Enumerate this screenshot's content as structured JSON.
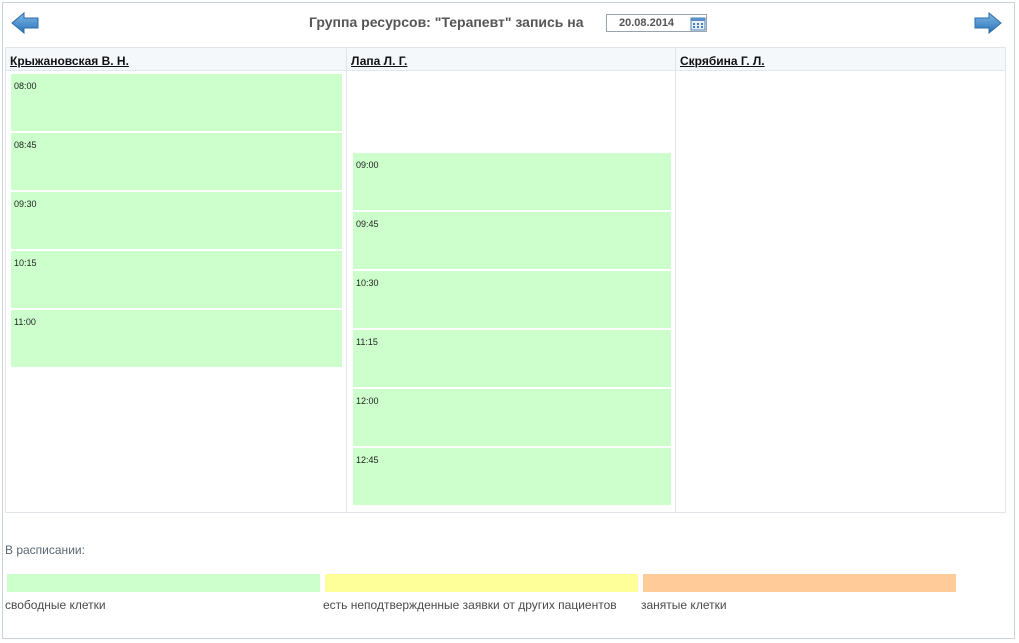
{
  "header": {
    "title": "Группа ресурсов: \"Терапевт\" запись на",
    "date": "20.08.2014",
    "prev_icon": "arrow-left-icon",
    "next_icon": "arrow-right-icon",
    "calendar_icon": "calendar-icon"
  },
  "columns": [
    {
      "name": "Крыжановская В. Н.",
      "slots": [
        "08:00",
        "08:45",
        "09:30",
        "10:15",
        "11:00"
      ]
    },
    {
      "name": "Лапа Л. Г.",
      "slots": [
        "09:00",
        "09:45",
        "10:30",
        "11:15",
        "12:00",
        "12:45"
      ]
    },
    {
      "name": "Скрябина Г. Л.",
      "slots": []
    }
  ],
  "legend": {
    "title": "В расписании:",
    "items": [
      {
        "label": "свободные клетки",
        "color": "#ccffcc"
      },
      {
        "label": "есть неподтвержденные заявки от других пациентов",
        "color": "#ffff99"
      },
      {
        "label": "занятые клетки",
        "color": "#ffcc99"
      }
    ]
  },
  "colors": {
    "slot_free": "#ccffcc",
    "arrow": "#3d87c9"
  }
}
